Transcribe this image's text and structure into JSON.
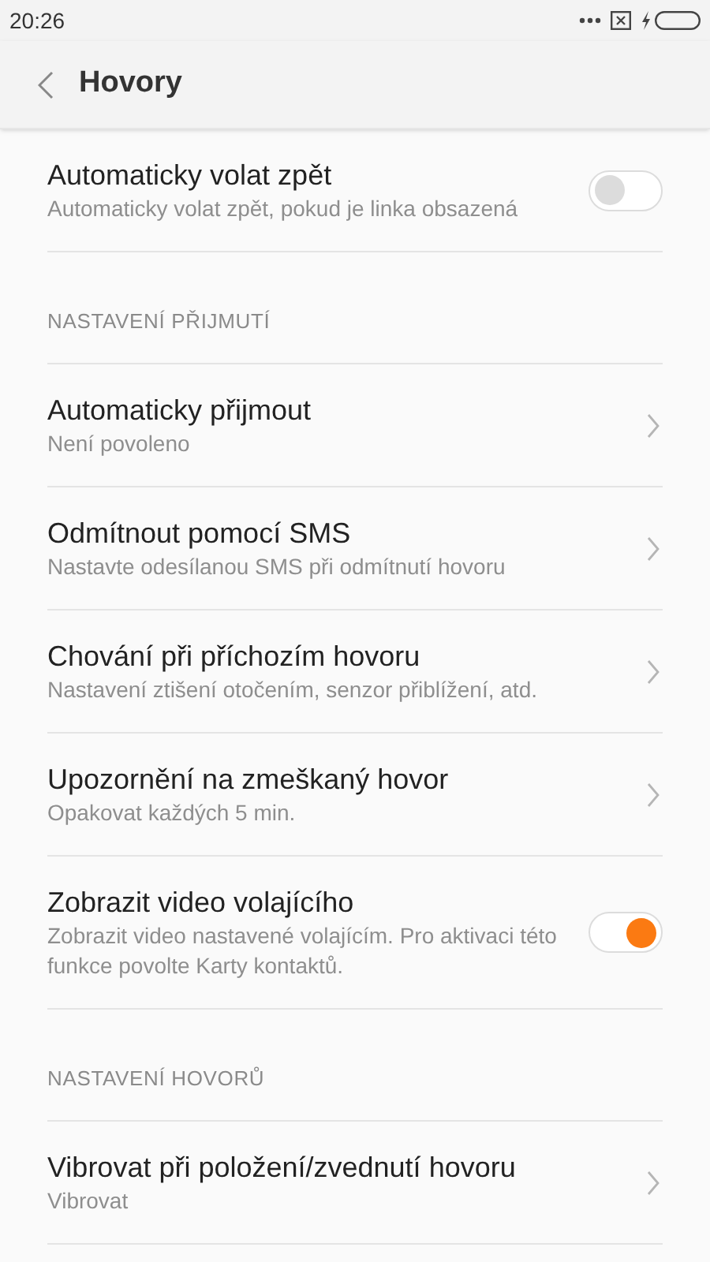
{
  "status_bar": {
    "time": "20:26"
  },
  "header": {
    "title": "Hovory"
  },
  "items": [
    {
      "kind": "toggle",
      "title": "Automaticky volat zpět",
      "subtitle": "Automaticky volat zpět, pokud je linka obsazená",
      "on": false
    },
    {
      "kind": "section",
      "title": "NASTAVENÍ PŘIJMUTÍ"
    },
    {
      "kind": "link",
      "title": "Automaticky přijmout",
      "subtitle": "Není povoleno"
    },
    {
      "kind": "link",
      "title": "Odmítnout pomocí SMS",
      "subtitle": "Nastavte odesílanou SMS při odmítnutí hovoru"
    },
    {
      "kind": "link",
      "title": "Chování při příchozím hovoru",
      "subtitle": "Nastavení ztišení otočením, senzor přiblížení, atd."
    },
    {
      "kind": "link",
      "title": "Upozornění na zmeškaný hovor",
      "subtitle": "Opakovat každých 5 min."
    },
    {
      "kind": "toggle",
      "title": "Zobrazit video volajícího",
      "subtitle": "Zobrazit video nastavené volajícím. Pro aktivaci této funkce povolte Karty kontaktů.",
      "on": true
    },
    {
      "kind": "section",
      "title": "NASTAVENÍ HOVORŮ"
    },
    {
      "kind": "link",
      "title": "Vibrovat při položení/zvednutí hovoru",
      "subtitle": "Vibrovat"
    }
  ]
}
